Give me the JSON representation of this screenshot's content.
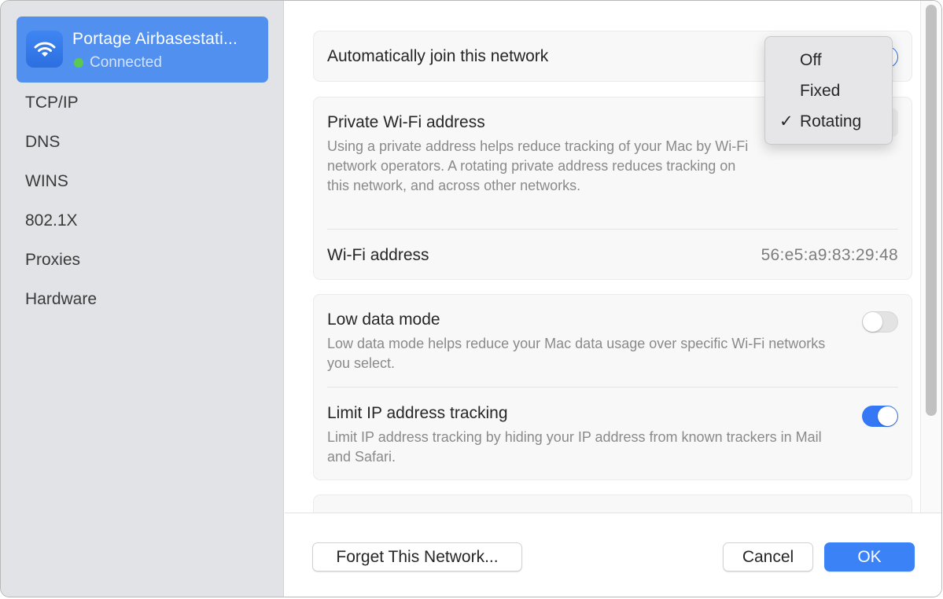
{
  "sidebar": {
    "network": {
      "name": "Portage Airbasestati...",
      "status": "Connected",
      "icon": "wifi-icon",
      "status_color": "#5ac94f"
    },
    "items": [
      {
        "label": "TCP/IP"
      },
      {
        "label": "DNS"
      },
      {
        "label": "WINS"
      },
      {
        "label": "802.1X"
      },
      {
        "label": "Proxies"
      },
      {
        "label": "Hardware"
      }
    ]
  },
  "settings": {
    "auto_join": {
      "title": "Automatically join this network",
      "enabled": true
    },
    "private_address": {
      "title": "Private Wi-Fi address",
      "description": "Using a private address helps reduce tracking of your Mac by Wi-Fi network operators. A rotating private address reduces tracking on this network, and across other networks.",
      "selected": "Rotating"
    },
    "wifi_address": {
      "label": "Wi-Fi address",
      "value": "56:e5:a9:83:29:48"
    },
    "low_data_mode": {
      "title": "Low data mode",
      "description": "Low data mode helps reduce your Mac data usage over specific Wi-Fi networks you select.",
      "enabled": false
    },
    "limit_ip_tracking": {
      "title": "Limit IP address tracking",
      "description": "Limit IP address tracking by hiding your IP address from known trackers in Mail and Safari.",
      "enabled": true
    }
  },
  "popup_menu": {
    "options": [
      {
        "label": "Off",
        "checked": false
      },
      {
        "label": "Fixed",
        "checked": false
      },
      {
        "label": "Rotating",
        "checked": true
      }
    ],
    "check_glyph": "✓"
  },
  "footer": {
    "forget_label": "Forget This Network...",
    "cancel_label": "Cancel",
    "ok_label": "OK"
  },
  "colors": {
    "accent": "#3478f6",
    "sidebar_selected": "#5290f0",
    "sidebar_bg": "#e2e3e7"
  }
}
